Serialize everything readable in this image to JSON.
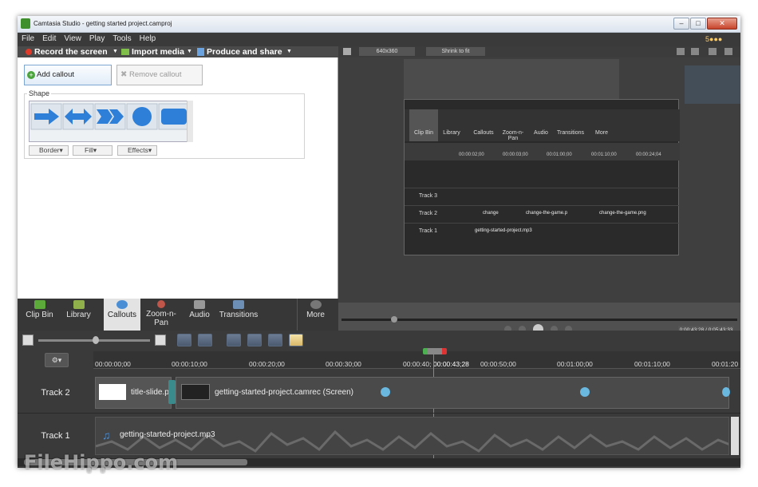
{
  "window": {
    "title": "Camtasia Studio - getting started project.camproj"
  },
  "menu": [
    "File",
    "Edit",
    "View",
    "Play",
    "Tools",
    "Help"
  ],
  "toolbar": {
    "record": "Record the screen",
    "import": "Import media",
    "produce": "Produce and share"
  },
  "callouts": {
    "add_label": "Add callout",
    "remove_label": "Remove callout",
    "shape_label": "Shape",
    "border_label": "Border",
    "fill_label": "Fill",
    "effects_label": "Effects"
  },
  "tabs": [
    {
      "label": "Clip Bin",
      "icon": "film-icon"
    },
    {
      "label": "Library",
      "icon": "library-icon"
    },
    {
      "label": "Callouts",
      "icon": "callout-icon"
    },
    {
      "label": "Zoom-n-Pan",
      "icon": "zoom-icon"
    },
    {
      "label": "Audio",
      "icon": "speaker-icon"
    },
    {
      "label": "Transitions",
      "icon": "transitions-icon"
    },
    {
      "label": "More",
      "icon": "more-icon"
    }
  ],
  "preview": {
    "size": "640x360",
    "fit": "Shrink to fit",
    "time": "0:00:43;28 / 0:05:43;33",
    "inner_tabs": [
      "Clip Bin",
      "Library",
      "Callouts",
      "Zoom-n-Pan",
      "Audio",
      "Transitions",
      "More"
    ],
    "inner_tracks": [
      "Track 3",
      "Track 2",
      "Track 1"
    ],
    "inner_clips": [
      "change",
      "change-the-game.p",
      "change-the-game.png",
      "getting-started-project.mp3"
    ],
    "inner_times": [
      "00:00:02;00",
      "00:00:03;00",
      "00:01:00;00",
      "00:01:10;00",
      "00:00:24;04"
    ]
  },
  "timeline": {
    "playhead": "00:00:43;28",
    "ticks": [
      "00:00:00;00",
      "00:00:10;00",
      "00:00:20;00",
      "00:00:30;00",
      "00:00:40;00",
      "00:00:50;00",
      "00:01:00;00",
      "00:01:10;00",
      "00:01:20"
    ],
    "tracks": [
      {
        "label": "Track 2",
        "clips": [
          "title-slide.p",
          "getting-started-project.camrec (Screen)"
        ]
      },
      {
        "label": "Track 1",
        "clips": [
          "getting-started-project.mp3"
        ]
      }
    ]
  },
  "watermark": "FileHippo.com",
  "colors": {
    "accent": "#4a8fd6",
    "record": "#e03a2a",
    "panel": "#3a3a3a"
  }
}
